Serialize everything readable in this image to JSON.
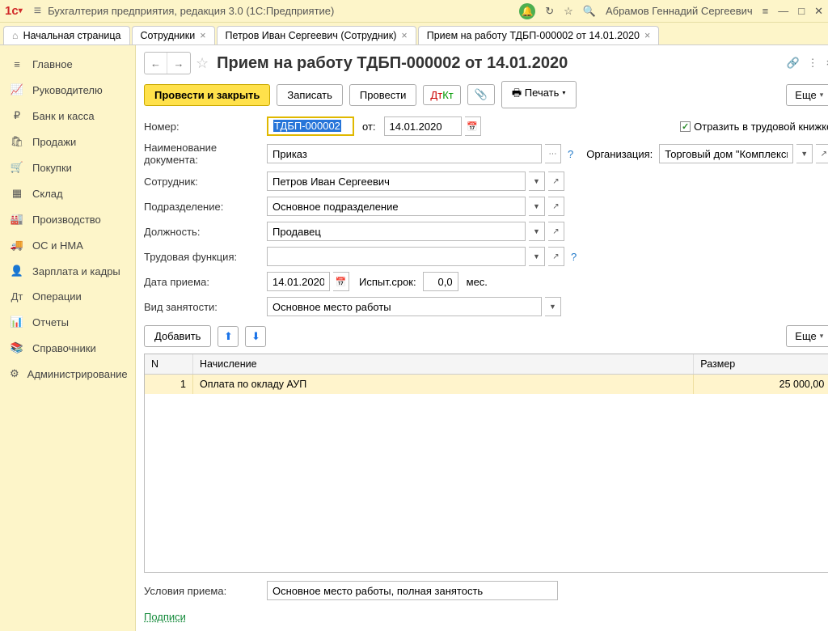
{
  "app": {
    "title": "Бухгалтерия предприятия, редакция 3.0  (1С:Предприятие)",
    "user": "Абрамов Геннадий Сергеевич"
  },
  "tabs": {
    "home": "Начальная страница",
    "t1": "Сотрудники",
    "t2": "Петров Иван Сергеевич (Сотрудник)",
    "t3": "Прием на работу ТДБП-000002 от 14.01.2020"
  },
  "sidebar": {
    "items": [
      {
        "icon": "≡",
        "label": "Главное"
      },
      {
        "icon": "📈",
        "label": "Руководителю"
      },
      {
        "icon": "₽",
        "label": "Банк и касса"
      },
      {
        "icon": "🛍",
        "label": "Продажи"
      },
      {
        "icon": "🛒",
        "label": "Покупки"
      },
      {
        "icon": "▦",
        "label": "Склад"
      },
      {
        "icon": "🏭",
        "label": "Производство"
      },
      {
        "icon": "🚚",
        "label": "ОС и НМА"
      },
      {
        "icon": "👤",
        "label": "Зарплата и кадры"
      },
      {
        "icon": "Дт",
        "label": "Операции"
      },
      {
        "icon": "📊",
        "label": "Отчеты"
      },
      {
        "icon": "📚",
        "label": "Справочники"
      },
      {
        "icon": "⚙",
        "label": "Администрирование"
      }
    ]
  },
  "doc": {
    "title": "Прием на работу ТДБП-000002 от 14.01.2020"
  },
  "toolbar": {
    "post_close": "Провести и закрыть",
    "write": "Записать",
    "post": "Провести",
    "print": "Печать",
    "more": "Еще"
  },
  "form": {
    "number_label": "Номер:",
    "number_value": "ТДБП-000002",
    "from_label": "от:",
    "date_value": "14.01.2020",
    "reflect_label": "Отразить в трудовой книжке",
    "docname_label": "Наименование документа:",
    "docname_value": "Приказ",
    "org_label": "Организация:",
    "org_value": "Торговый дом \"Комплексный\"",
    "employee_label": "Сотрудник:",
    "employee_value": "Петров Иван Сергеевич",
    "dept_label": "Подразделение:",
    "dept_value": "Основное подразделение",
    "position_label": "Должность:",
    "position_value": "Продавец",
    "func_label": "Трудовая функция:",
    "func_value": "",
    "hiredate_label": "Дата приема:",
    "hiredate_value": "14.01.2020",
    "probation_label": "Испыт.срок:",
    "probation_value": "0,0",
    "probation_unit": "мес.",
    "emptype_label": "Вид занятости:",
    "emptype_value": "Основное место работы",
    "add": "Добавить",
    "conditions_label": "Условия приема:",
    "conditions_value": "Основное место работы, полная занятость",
    "sign_link": "Подписи"
  },
  "table": {
    "col_n": "N",
    "col_name": "Начисление",
    "col_size": "Размер",
    "rows": [
      {
        "n": "1",
        "name": "Оплата по окладу АУП",
        "size": "25 000,00"
      }
    ]
  }
}
